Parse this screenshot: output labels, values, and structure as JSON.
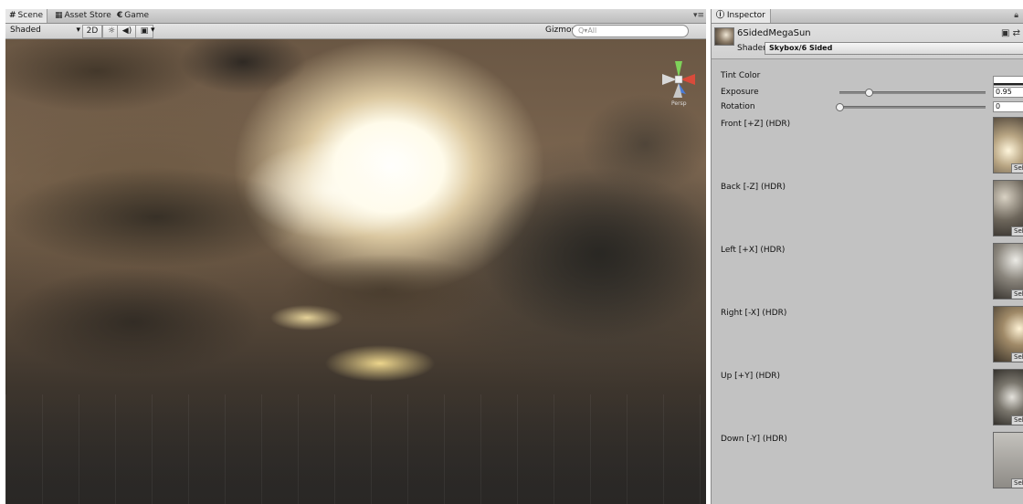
{
  "scene_panel": {
    "tabs": [
      {
        "icon": "#",
        "label": "Scene"
      },
      {
        "icon": "▦",
        "label": "Asset Store"
      },
      {
        "icon": "€",
        "label": "Game"
      }
    ],
    "menu_glyph": "▾≡",
    "toolbar": {
      "shading_mode": "Shaded",
      "mode_2d": "2D",
      "light_glyph": "☼",
      "audio_glyph": "◀)",
      "effects_glyph": "▣",
      "gizmos_label": "Gizmos",
      "search_placeholder": "Q▾All"
    },
    "gizmo": {
      "persp_label": "Persp"
    }
  },
  "inspector": {
    "tab_label": "Inspector",
    "material_name": "6SidedMegaSun",
    "shader_label": "Shader",
    "shader_value": "Skybox/6 Sided",
    "properties": {
      "tint_label": "Tint Color",
      "tint_color": "#ffffff",
      "exposure_label": "Exposure",
      "exposure_value": "0.95",
      "exposure_fraction": 0.2,
      "rotation_label": "Rotation",
      "rotation_value": "0",
      "rotation_fraction": 0.0
    },
    "textures": [
      {
        "label": "Front [+Z]  (HDR)",
        "select": "Sele"
      },
      {
        "label": "Back [-Z]  (HDR)",
        "select": "Sele"
      },
      {
        "label": "Left [+X]  (HDR)",
        "select": "Sele"
      },
      {
        "label": "Right [-X]  (HDR)",
        "select": "Sele"
      },
      {
        "label": "Up [+Y]  (HDR)",
        "select": "Sele"
      },
      {
        "label": "Down [-Y]  (HDR)",
        "select": "Sele"
      }
    ]
  }
}
